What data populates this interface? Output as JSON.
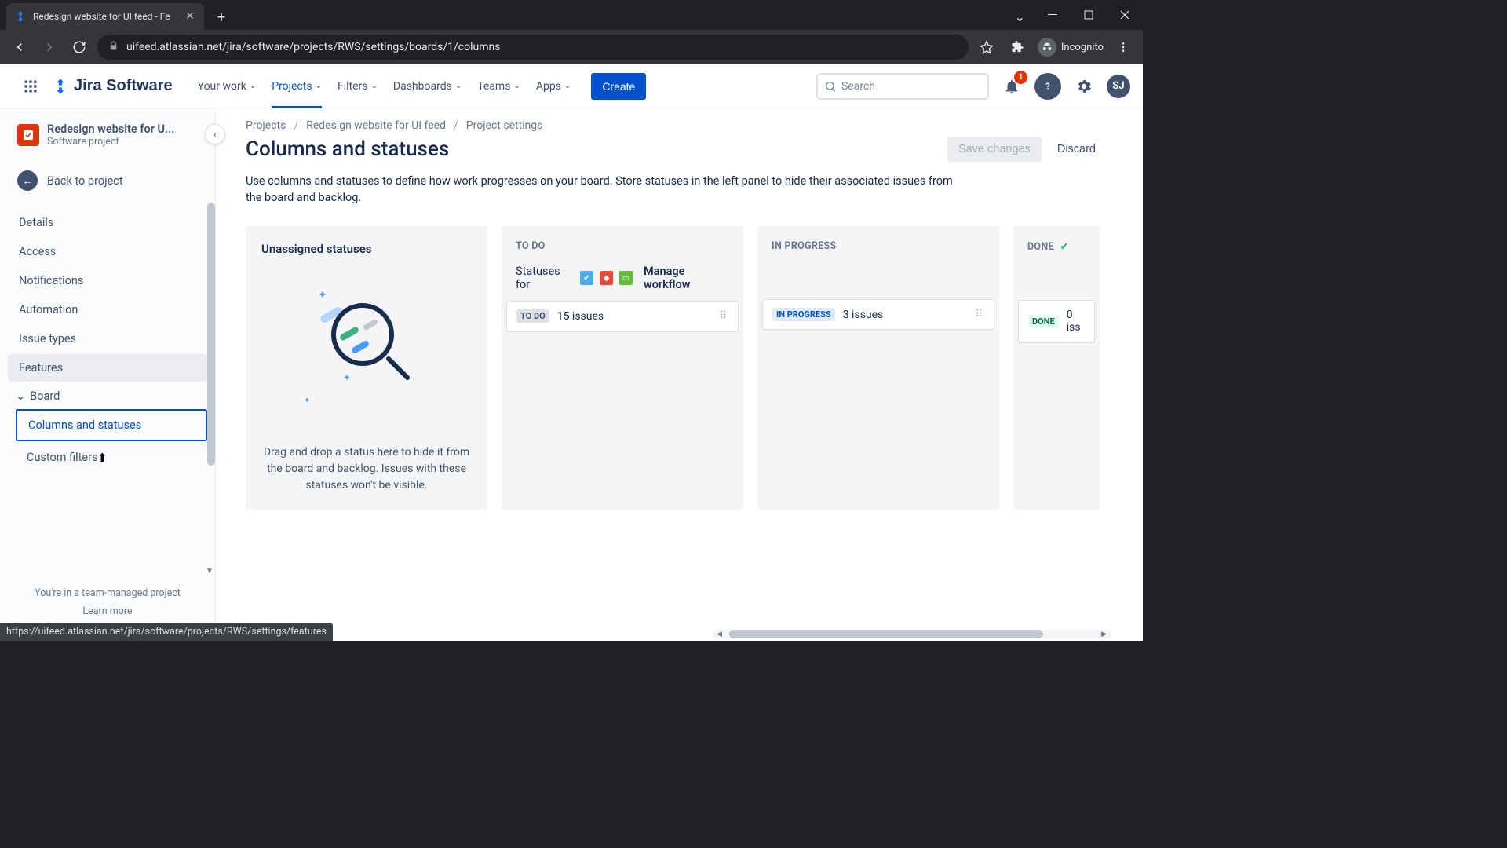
{
  "browser": {
    "tab_title": "Redesign website for UI feed - Fe",
    "url": "uifeed.atlassian.net/jira/software/projects/RWS/settings/boards/1/columns",
    "incognito_label": "Incognito",
    "link_preview": "https://uifeed.atlassian.net/jira/software/projects/RWS/settings/features"
  },
  "topnav": {
    "logo": "Jira Software",
    "items": [
      "Your work",
      "Projects",
      "Filters",
      "Dashboards",
      "Teams",
      "Apps"
    ],
    "active_index": 1,
    "create_label": "Create",
    "search_placeholder": "Search",
    "notif_count": "1",
    "avatar_initials": "SJ"
  },
  "sidebar": {
    "project_title": "Redesign website for U...",
    "project_subtitle": "Software project",
    "back_label": "Back to project",
    "items": {
      "details": "Details",
      "access": "Access",
      "notifications": "Notifications",
      "automation": "Automation",
      "issue_types": "Issue types",
      "features": "Features",
      "board_section": "Board",
      "columns_statuses": "Columns and statuses",
      "custom_filters": "Custom filters"
    },
    "footer_line": "You're in a team-managed project",
    "footer_link": "Learn more"
  },
  "page": {
    "breadcrumbs": [
      "Projects",
      "Redesign website for UI feed",
      "Project settings"
    ],
    "title": "Columns and statuses",
    "save_label": "Save changes",
    "discard_label": "Discard",
    "description": "Use columns and statuses to define how work progresses on your board. Store statuses in the left panel to hide their associated issues from the board and backlog."
  },
  "unassigned": {
    "title": "Unassigned statuses",
    "help_text": "Drag and drop a status here to hide it from the board and backlog. Issues with these statuses won't be visible."
  },
  "statuses_for_label": "Statuses for",
  "manage_workflow_label": "Manage workflow",
  "columns": [
    {
      "name": "TO DO",
      "status_lozenge": "TO DO",
      "lozenge_class": "loz-todo",
      "issue_count": "15 issues",
      "done": false
    },
    {
      "name": "IN PROGRESS",
      "status_lozenge": "IN PROGRESS",
      "lozenge_class": "loz-inprog",
      "issue_count": "3 issues",
      "done": false
    },
    {
      "name": "DONE",
      "status_lozenge": "DONE",
      "lozenge_class": "loz-done",
      "issue_count": "0 iss",
      "done": true
    }
  ]
}
